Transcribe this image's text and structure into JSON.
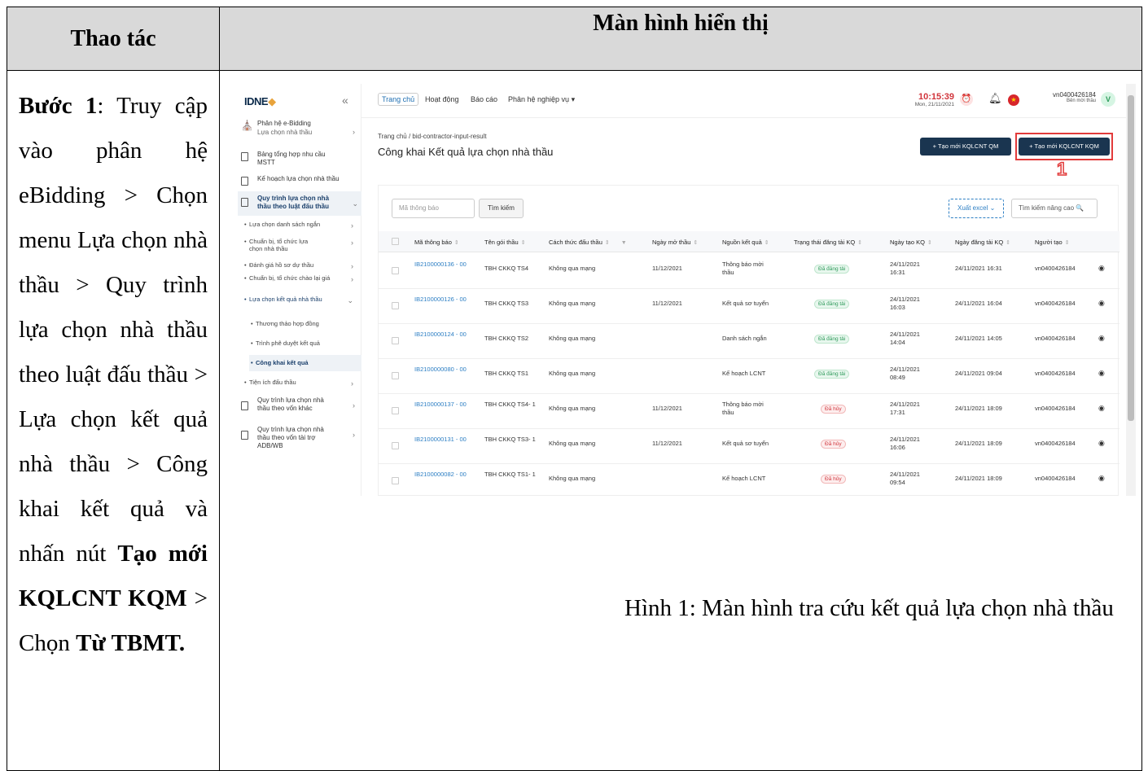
{
  "doc": {
    "header_left": "Thao tác",
    "header_right": "Màn hình hiển thị",
    "step": {
      "prefix": "Bước 1",
      "text1": ": Truy cập vào phân hệ eBidding > Chọn menu Lựa chọn nhà thầu > Quy trình lựa chọn nhà thầu theo luật đấu thầu > Lựa chọn kết quả nhà thầu > Công khai kết quả và nhấn nút ",
      "bold1": "Tạo mới KQLCNT KQM",
      "text2": " > Chọn ",
      "bold2": "Từ TBMT."
    },
    "caption": "Hình 1: Màn hình tra cứu kết quả lựa chọn nhà thầu"
  },
  "app": {
    "logo": "IDNE",
    "sidebar": {
      "module_title": "Phân hệ e-Bidding",
      "module_sub": "Lựa chọn nhà thầu",
      "items": [
        "Bảng tổng hợp nhu cầu MSTT",
        "Kế hoạch lựa chọn nhà thầu",
        "Quy trình lựa chọn nhà thầu theo luật đấu thầu"
      ],
      "subitems": [
        "Lựa chọn danh sách ngắn",
        "Chuẩn bị, tổ chức lựa chọn nhà thầu",
        "Đánh giá hồ sơ dự thầu",
        "Chuẩn bị, tổ chức chào lại giá",
        "Lựa chọn kết quả nhà thầu"
      ],
      "subsub": [
        "Thương thảo hợp đồng",
        "Trình phê duyệt kết quả",
        "Công khai kết quả"
      ],
      "tienich": "Tiện ích đấu thầu",
      "bottom_items": [
        "Quy trình lựa chọn nhà thầu theo vốn khác",
        "Quy trình lựa chọn nhà thầu theo vốn tài trợ ADB/WB"
      ]
    },
    "topbar": {
      "nav": [
        "Trang chủ",
        "Hoạt động",
        "Báo cáo",
        "Phân hệ nghiệp vụ ▾"
      ],
      "time": "10:15:39",
      "date": "Mon, 21/11/2021",
      "user_name": "vn0400426184",
      "user_role": "Bên mời thầu",
      "avatar": "V"
    },
    "breadcrumb": "Trang chủ  /  bid-contractor-input-result",
    "page_title": "Công khai Kết quả lựa chọn nhà thầu",
    "btn_qm": "+  Tạo mới KQLCNT QM",
    "btn_kqm": "+  Tạo mới KQLCNT KQM",
    "marker": "1",
    "search_placeholder": "Mã thông báo",
    "search_btn": "Tìm kiếm",
    "excel_btn": "Xuất excel  ⌄",
    "adv_search": "Tìm kiếm nâng cao 🔍",
    "columns": [
      "Mã thông báo",
      "Tên gói thầu",
      "Cách thức đấu thầu",
      "Ngày mở thầu",
      "Nguồn kết quả",
      "Trạng thái đăng tải KQ",
      "Ngày tạo KQ",
      "Ngày đăng tải KQ",
      "Người tạo"
    ],
    "rows": [
      {
        "ma": "IB2100000136 - 00",
        "ten": "TBH CKKQ TS4",
        "cach": "Không qua mạng",
        "ngay_mo": "11/12/2021",
        "nguon": "Thông báo mời thầu",
        "status": "Đã đăng tải",
        "ok": true,
        "ngay_tao": "24/11/2021 16:31",
        "ngay_dang": "24/11/2021 16:31",
        "nguoi": "vn0400426184"
      },
      {
        "ma": "IB2100000126 - 00",
        "ten": "TBH CKKQ TS3",
        "cach": "Không qua mạng",
        "ngay_mo": "11/12/2021",
        "nguon": "Kết quả sơ tuyển",
        "status": "Đã đăng tải",
        "ok": true,
        "ngay_tao": "24/11/2021 16:03",
        "ngay_dang": "24/11/2021 16:04",
        "nguoi": "vn0400426184"
      },
      {
        "ma": "IB2100000124 - 00",
        "ten": "TBH CKKQ TS2",
        "cach": "Không qua mạng",
        "ngay_mo": "",
        "nguon": "Danh sách ngắn",
        "status": "Đã đăng tải",
        "ok": true,
        "ngay_tao": "24/11/2021 14:04",
        "ngay_dang": "24/11/2021 14:05",
        "nguoi": "vn0400426184"
      },
      {
        "ma": "IB2100000080 - 00",
        "ten": "TBH CKKQ TS1",
        "cach": "Không qua mạng",
        "ngay_mo": "",
        "nguon": "Kế hoạch LCNT",
        "status": "Đã đăng tải",
        "ok": true,
        "ngay_tao": "24/11/2021 08:49",
        "ngay_dang": "24/11/2021 09:04",
        "nguoi": "vn0400426184"
      },
      {
        "ma": "IB2100000137 - 00",
        "ten": "TBH CKKQ TS4- 1",
        "cach": "Không qua mạng",
        "ngay_mo": "11/12/2021",
        "nguon": "Thông báo mời thầu",
        "status": "Đã hủy",
        "ok": false,
        "ngay_tao": "24/11/2021 17:31",
        "ngay_dang": "24/11/2021 18:09",
        "nguoi": "vn0400426184"
      },
      {
        "ma": "IB2100000131 - 00",
        "ten": "TBH CKKQ TS3- 1",
        "cach": "Không qua mạng",
        "ngay_mo": "11/12/2021",
        "nguon": "Kết quả sơ tuyển",
        "status": "Đã hủy",
        "ok": false,
        "ngay_tao": "24/11/2021 16:06",
        "ngay_dang": "24/11/2021 18:09",
        "nguoi": "vn0400426184"
      },
      {
        "ma": "IB2100000082 - 00",
        "ten": "TBH CKKQ TS1- 1",
        "cach": "Không qua mạng",
        "ngay_mo": "",
        "nguon": "Kế hoạch LCNT",
        "status": "Đã hủy",
        "ok": false,
        "ngay_tao": "24/11/2021 09:54",
        "ngay_dang": "24/11/2021 18:09",
        "nguoi": "vn0400426184"
      }
    ]
  }
}
